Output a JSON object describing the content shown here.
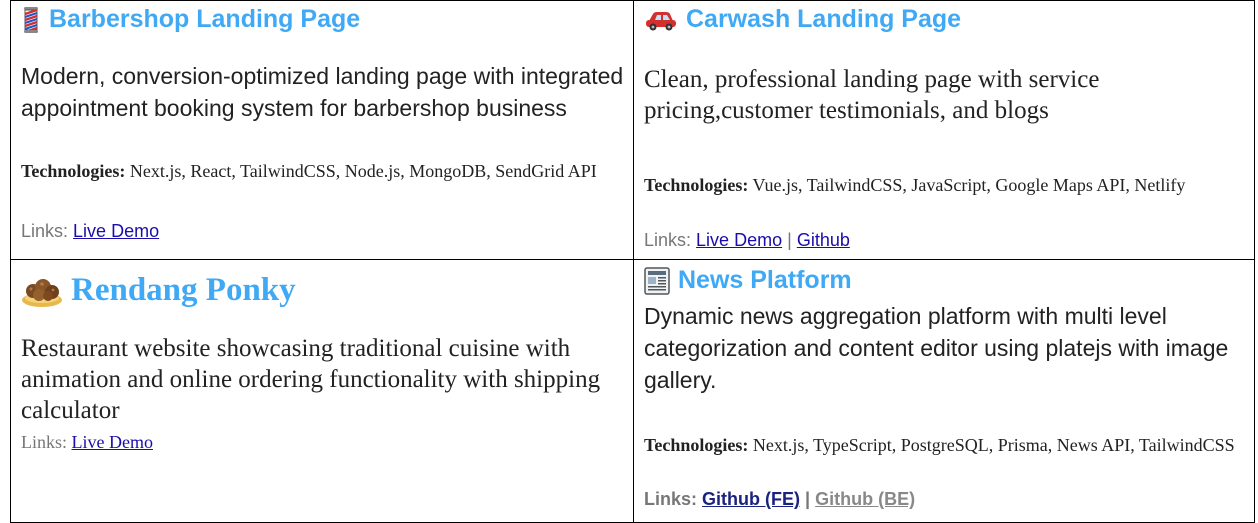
{
  "cards": [
    {
      "icon": "barber-pole-icon",
      "title": "Barbershop Landing Page",
      "description": "Modern, conversion-optimized landing page with integrated appointment booking system for barbershop business",
      "tech_label": "Technologies:",
      "tech": "Next.js, React, TailwindCSS, Node.js, MongoDB, SendGrid API",
      "links_label": "Links:",
      "links": [
        "Live Demo"
      ]
    },
    {
      "icon": "car-icon",
      "title": "Carwash Landing Page",
      "description": "Clean, professional landing page with service pricing,customer testimonials, and blogs",
      "tech_label": "Technologies:",
      "tech": "Vue.js, TailwindCSS, JavaScript, Google Maps API, Netlify",
      "links_label": "Links:",
      "links": [
        "Live Demo",
        "Github"
      ],
      "separator": "|"
    },
    {
      "icon": "rendang-dish-icon",
      "title": "Rendang Ponky",
      "description": "Restaurant website showcasing traditional cuisine with animation and online ordering functionality with shipping calculator",
      "links_label": "Links:",
      "links": [
        "Live Demo"
      ]
    },
    {
      "icon": "newspaper-icon",
      "title": "News Platform",
      "description": "Dynamic news aggregation platform with multi level categorization and content editor using platejs with image gallery.",
      "tech_label": "Technologies:",
      "tech": "Next.js, TypeScript, PostgreSQL, Prisma, News API, TailwindCSS",
      "links_label": "Links:",
      "links": [
        "Github (FE)",
        "Github (BE)"
      ],
      "separator": "|"
    }
  ],
  "colors": {
    "title": "#3fa9f5",
    "link": "#1a0dab",
    "muted": "#777777"
  }
}
